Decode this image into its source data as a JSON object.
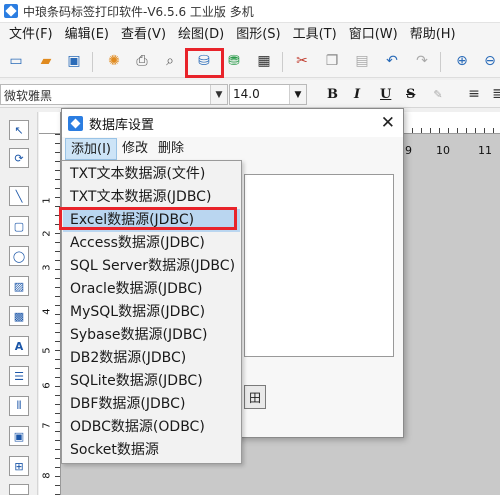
{
  "window": {
    "title": "中琅条码标签打印软件-V6.5.6 工业版 多机"
  },
  "menubar": [
    {
      "label": "文件(F)"
    },
    {
      "label": "编辑(E)"
    },
    {
      "label": "查看(V)"
    },
    {
      "label": "绘图(D)"
    },
    {
      "label": "图形(S)"
    },
    {
      "label": "工具(T)"
    },
    {
      "label": "窗口(W)"
    },
    {
      "label": "帮助(H)"
    }
  ],
  "formatbar": {
    "font": "微软雅黑",
    "size": "14.0",
    "bold": "B",
    "italic": "I",
    "underline": "U",
    "strike": "S"
  },
  "ruler": {
    "h_labels": [
      "9",
      "10",
      "11"
    ],
    "v_labels": [
      "1",
      "2",
      "3",
      "4",
      "5",
      "6",
      "7",
      "8"
    ]
  },
  "dialog": {
    "title": "数据库设置",
    "close": "✕",
    "menu": [
      {
        "label": "添加(I)"
      },
      {
        "label": "修改"
      },
      {
        "label": "删除"
      }
    ],
    "button_fragment": "田"
  },
  "dropdown": {
    "items": [
      {
        "label": "TXT文本数据源(文件)"
      },
      {
        "label": "TXT文本数据源(JDBC)"
      },
      {
        "label": "Excel数据源(JDBC)"
      },
      {
        "label": "Access数据源(JDBC)"
      },
      {
        "label": "SQL Server数据源(JDBC)"
      },
      {
        "label": "Oracle数据源(JDBC)"
      },
      {
        "label": "MySQL数据源(JDBC)"
      },
      {
        "label": "Sybase数据源(JDBC)"
      },
      {
        "label": "DB2数据源(JDBC)"
      },
      {
        "label": "SQLite数据源(JDBC)"
      },
      {
        "label": "DBF数据源(JDBC)"
      },
      {
        "label": "ODBC数据源(ODBC)"
      },
      {
        "label": "Socket数据源"
      }
    ],
    "selected": "Excel数据源(JDBC)"
  },
  "colors": {
    "highlight_red": "#e8232a",
    "selection": "#bad6f0",
    "accent": "#2b7de1"
  }
}
